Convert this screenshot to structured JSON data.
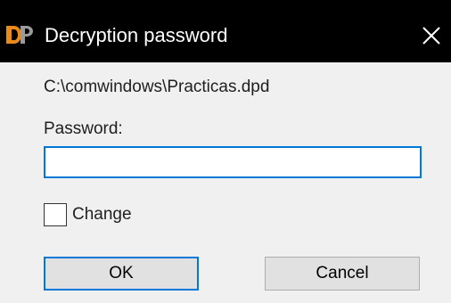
{
  "window": {
    "title": "Decryption password",
    "app_icon": "dp-app-icon",
    "close_icon": "close-icon"
  },
  "dialog": {
    "file_path": "C:\\comwindows\\Practicas.dpd",
    "password_label": "Password:",
    "password_value": "",
    "change_checkbox": {
      "label": "Change",
      "checked": false
    },
    "ok_label": "OK",
    "cancel_label": "Cancel"
  },
  "colors": {
    "titlebar": "#000000",
    "background": "#f0f0f0",
    "accent": "#0078d7",
    "icon_orange": "#e98a1c"
  }
}
